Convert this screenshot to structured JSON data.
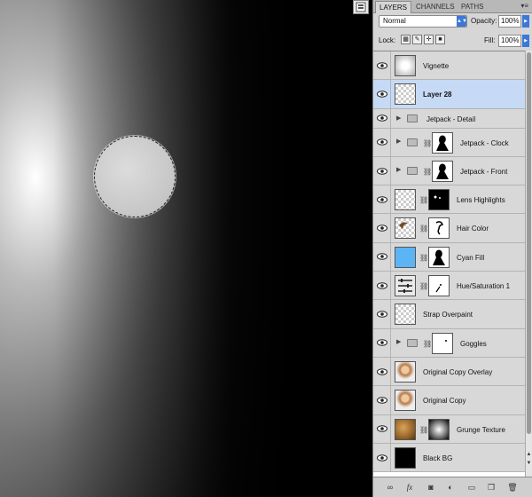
{
  "panel": {
    "tabs": [
      {
        "label": "LAYERS",
        "active": true
      },
      {
        "label": "CHANNELS",
        "active": false
      },
      {
        "label": "PATHS",
        "active": false
      }
    ],
    "blend_mode": "Normal",
    "opacity_label": "Opacity:",
    "opacity_value": "100%",
    "lock_label": "Lock:",
    "fill_label": "Fill:",
    "fill_value": "100%"
  },
  "layers": [
    {
      "name": "Vignette",
      "thumb": "vignette",
      "mask": null,
      "type": "layer",
      "selected": false
    },
    {
      "name": "Layer 28",
      "thumb": "checker",
      "mask": null,
      "type": "layer",
      "selected": true
    },
    {
      "name": "Jetpack - Detail",
      "thumb": null,
      "mask": null,
      "type": "group",
      "selected": false
    },
    {
      "name": "Jetpack - Clock",
      "thumb": null,
      "mask": "silhouette",
      "type": "group",
      "selected": false
    },
    {
      "name": "Jetpack - Front",
      "thumb": null,
      "mask": "silhouette",
      "type": "group",
      "selected": false
    },
    {
      "name": "Lens Highlights",
      "thumb": "checker",
      "mask": "dots",
      "type": "layer",
      "selected": false
    },
    {
      "name": "Hair Color",
      "thumb": "checker",
      "mask": "hair",
      "type": "layer",
      "selected": false
    },
    {
      "name": "Cyan Fill",
      "thumb": "cyan",
      "mask": "silhouette",
      "type": "layer",
      "selected": false
    },
    {
      "name": "Hue/Saturation 1",
      "thumb": "huesat",
      "mask": "stroke",
      "type": "adjustment",
      "selected": false
    },
    {
      "name": "Strap Overpaint",
      "thumb": "checker",
      "mask": null,
      "type": "layer",
      "selected": false
    },
    {
      "name": "Goggles",
      "thumb": null,
      "mask": "dot",
      "type": "group",
      "selected": false
    },
    {
      "name": "Original Copy Overlay",
      "thumb": "portrait",
      "mask": null,
      "type": "layer",
      "selected": false
    },
    {
      "name": "Original Copy",
      "thumb": "portrait",
      "mask": null,
      "type": "layer",
      "selected": false
    },
    {
      "name": "Grunge Texture",
      "thumb": "grunge",
      "mask": "radial",
      "type": "layer",
      "selected": false
    },
    {
      "name": "Black BG",
      "thumb": "black",
      "mask": null,
      "type": "layer",
      "selected": false
    }
  ],
  "colors": {
    "selected_row": "#c6daf5",
    "accent": "#3b78d8",
    "panel_bg": "#d6d6d6"
  },
  "icons": [
    "eye-icon",
    "chain-link-icon",
    "folder-icon",
    "fx-icon",
    "mask-icon",
    "adjustment-icon",
    "new-group-icon",
    "new-layer-icon",
    "trash-icon"
  ]
}
